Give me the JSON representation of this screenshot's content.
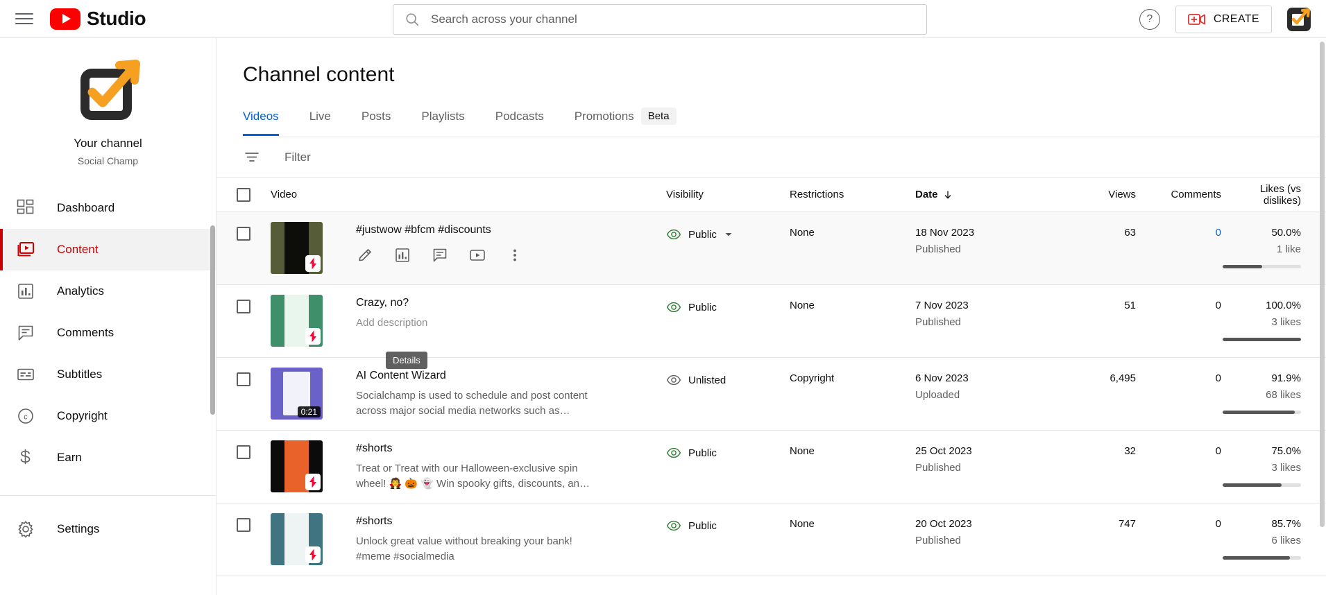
{
  "topbar": {
    "menu_icon": "hamburger-icon",
    "brand": "Studio",
    "search": {
      "placeholder": "Search across your channel",
      "value": "",
      "icon": "search-icon"
    },
    "help_label": "?",
    "create_label": "CREATE",
    "create_icon": "video-plus-icon",
    "account_icon": "account-avatar-icon"
  },
  "sidebar": {
    "channel_label": "Your channel",
    "channel_name": "Social Champ",
    "items": [
      {
        "label": "Dashboard",
        "icon": "dashboard-icon",
        "active": false
      },
      {
        "label": "Content",
        "icon": "content-video-icon",
        "active": true
      },
      {
        "label": "Analytics",
        "icon": "analytics-bar-icon",
        "active": false
      },
      {
        "label": "Comments",
        "icon": "comments-bubble-icon",
        "active": false
      },
      {
        "label": "Subtitles",
        "icon": "subtitles-icon",
        "active": false
      },
      {
        "label": "Copyright",
        "icon": "copyright-icon",
        "active": false
      },
      {
        "label": "Earn",
        "icon": "dollar-icon",
        "active": false
      }
    ],
    "settings_label": "Settings",
    "settings_icon": "gear-icon"
  },
  "main": {
    "page_title": "Channel content",
    "tabs": [
      {
        "label": "Videos",
        "active": true
      },
      {
        "label": "Live",
        "active": false
      },
      {
        "label": "Posts",
        "active": false
      },
      {
        "label": "Playlists",
        "active": false
      },
      {
        "label": "Podcasts",
        "active": false
      },
      {
        "label": "Promotions",
        "active": false
      }
    ],
    "beta_chip": "Beta",
    "filter": {
      "placeholder": "Filter",
      "value": "",
      "icon": "filter-icon"
    },
    "columns": {
      "video": "Video",
      "visibility": "Visibility",
      "restrictions": "Restrictions",
      "date": "Date",
      "date_sort_icon": "arrow-down-icon",
      "views": "Views",
      "comments": "Comments",
      "likes": "Likes (vs dislikes)"
    },
    "tooltip": "Details",
    "row_actions": [
      {
        "name": "edit-details",
        "icon": "pencil-icon"
      },
      {
        "name": "view-analytics",
        "icon": "analytics-bar-icon"
      },
      {
        "name": "view-comments",
        "icon": "comment-icon"
      },
      {
        "name": "view-on-youtube",
        "icon": "play-box-icon"
      },
      {
        "name": "more-options",
        "icon": "kebab-menu-icon"
      }
    ],
    "rows": [
      {
        "title": "#justwow #bfcm #discounts",
        "description": "",
        "thumb_kind": "shorts",
        "thumb_bg": "#565b38",
        "thumb_center": "#0d0d0a",
        "duration": "",
        "visibility": "Public",
        "visibility_color": "#2e7d32",
        "has_vis_dropdown": true,
        "restrictions": "None",
        "date": "18 Nov 2023",
        "date_status": "Published",
        "views": "63",
        "comments": "0",
        "comments_link": true,
        "likes_pct": "50.0%",
        "likes_count": "1 like",
        "bar_pct": 50.0,
        "hover": true,
        "show_actions": true
      },
      {
        "title": "Crazy, no?",
        "description": "Add description",
        "description_placeholder": true,
        "thumb_kind": "shorts",
        "thumb_bg": "#3f8f6b",
        "thumb_center": "#e8f6ee",
        "duration": "",
        "visibility": "Public",
        "visibility_color": "#2e7d32",
        "has_vis_dropdown": false,
        "restrictions": "None",
        "date": "7 Nov 2023",
        "date_status": "Published",
        "views": "51",
        "comments": "0",
        "comments_link": false,
        "likes_pct": "100.0%",
        "likes_count": "3 likes",
        "bar_pct": 100.0,
        "hover": false,
        "show_actions": false
      },
      {
        "title": "AI Content Wizard",
        "description": "Socialchamp is used to schedule and post content across major social media networks such as…",
        "thumb_kind": "video",
        "thumb_bg": "#6b62c9",
        "thumb_center": "#f2f2fa",
        "duration": "0:21",
        "visibility": "Unlisted",
        "visibility_color": "#606060",
        "has_vis_dropdown": false,
        "restrictions": "Copyright",
        "date": "6 Nov 2023",
        "date_status": "Uploaded",
        "views": "6,495",
        "comments": "0",
        "comments_link": false,
        "likes_pct": "91.9%",
        "likes_count": "68 likes",
        "bar_pct": 91.9,
        "hover": false,
        "show_actions": false
      },
      {
        "title": "#shorts",
        "description": "Treat or Treat with our Halloween-exclusive spin wheel! 🧛 🎃 👻 Win spooky gifts, discounts, an…",
        "thumb_kind": "shorts",
        "thumb_bg": "#0b0b0b",
        "thumb_center": "#e8622a",
        "duration": "",
        "visibility": "Public",
        "visibility_color": "#2e7d32",
        "has_vis_dropdown": false,
        "restrictions": "None",
        "date": "25 Oct 2023",
        "date_status": "Published",
        "views": "32",
        "comments": "0",
        "comments_link": false,
        "likes_pct": "75.0%",
        "likes_count": "3 likes",
        "bar_pct": 75.0,
        "hover": false,
        "show_actions": false
      },
      {
        "title": "#shorts",
        "description": "Unlock great value without breaking your bank! #meme #socialmedia",
        "thumb_kind": "shorts",
        "thumb_bg": "#3f7480",
        "thumb_center": "#eef3f4",
        "duration": "",
        "visibility": "Public",
        "visibility_color": "#2e7d32",
        "has_vis_dropdown": false,
        "restrictions": "None",
        "date": "20 Oct 2023",
        "date_status": "Published",
        "views": "747",
        "comments": "0",
        "comments_link": false,
        "likes_pct": "85.7%",
        "likes_count": "6 likes",
        "bar_pct": 85.7,
        "hover": false,
        "show_actions": false
      }
    ]
  },
  "colors": {
    "brand_red": "#ff0000",
    "active_red": "#cc0000",
    "link_blue": "#065fd4",
    "public_green": "#2e7d32",
    "accent_orange": "#f5a020"
  }
}
